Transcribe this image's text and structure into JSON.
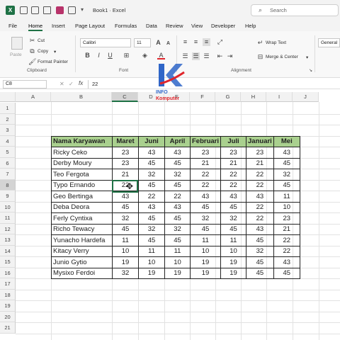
{
  "titlebar": {
    "title": "Book1 · Excel",
    "search_placeholder": "Search"
  },
  "menu": [
    "File",
    "Home",
    "Insert",
    "Page Layout",
    "Formulas",
    "Data",
    "Review",
    "View",
    "Developer",
    "Help"
  ],
  "ribbon": {
    "cut": "Cut",
    "copy": "Copy",
    "format_painter": "Format Painter",
    "paste": "Paste",
    "font_name": "Calibri",
    "font_size": "11",
    "wrap_text": "Wrap Text",
    "merge_center": "Merge & Center",
    "number_format": "General",
    "groups": {
      "clipboard": "Clipboard",
      "font": "Font",
      "alignment": "Alignment"
    }
  },
  "formula_bar": {
    "cell_ref": "C8",
    "fx": "fx",
    "value": "22"
  },
  "watermark": {
    "line1": "INFO",
    "line2": "Komputer"
  },
  "columns": [
    "A",
    "B",
    "C",
    "D",
    "E",
    "F",
    "G",
    "H",
    "I",
    "J"
  ],
  "rows": [
    "1",
    "2",
    "3",
    "4",
    "5",
    "6",
    "7",
    "8",
    "9",
    "10",
    "11",
    "12",
    "13",
    "14",
    "15",
    "16",
    "17",
    "18",
    "19",
    "20",
    "21"
  ],
  "table": {
    "headers": [
      "Nama Karyawan",
      "Maret",
      "Juni",
      "April",
      "Februari",
      "Juli",
      "Januari",
      "Mei"
    ],
    "rows": [
      [
        "Ricky Ceko",
        "23",
        "43",
        "43",
        "23",
        "23",
        "23",
        "43"
      ],
      [
        "Derby Moury",
        "23",
        "45",
        "45",
        "21",
        "21",
        "21",
        "45"
      ],
      [
        "Teo Fergota",
        "21",
        "32",
        "32",
        "22",
        "22",
        "22",
        "32"
      ],
      [
        "Typo Ernando",
        "22",
        "45",
        "45",
        "22",
        "22",
        "22",
        "45"
      ],
      [
        "Geo Bertinga",
        "43",
        "22",
        "22",
        "43",
        "43",
        "43",
        "11"
      ],
      [
        "Deba Deora",
        "45",
        "43",
        "43",
        "45",
        "45",
        "22",
        "10"
      ],
      [
        "Ferly Cyntixa",
        "32",
        "45",
        "45",
        "32",
        "32",
        "22",
        "23"
      ],
      [
        "Richo Tewacy",
        "45",
        "32",
        "32",
        "45",
        "45",
        "43",
        "21"
      ],
      [
        "Yunacho Hardefa",
        "11",
        "45",
        "45",
        "11",
        "11",
        "45",
        "22"
      ],
      [
        "Kitacy Verry",
        "10",
        "11",
        "11",
        "10",
        "10",
        "32",
        "22"
      ],
      [
        "Junio Gytio",
        "19",
        "10",
        "10",
        "19",
        "19",
        "45",
        "43"
      ],
      [
        "Mysixo Ferdoi",
        "32",
        "19",
        "19",
        "19",
        "19",
        "45",
        "45"
      ]
    ]
  },
  "colors": {
    "header_fill": "#a9d08e",
    "excel_green": "#1e7145",
    "watermark_blue": "#2f66c8",
    "watermark_red": "#e0252b"
  }
}
